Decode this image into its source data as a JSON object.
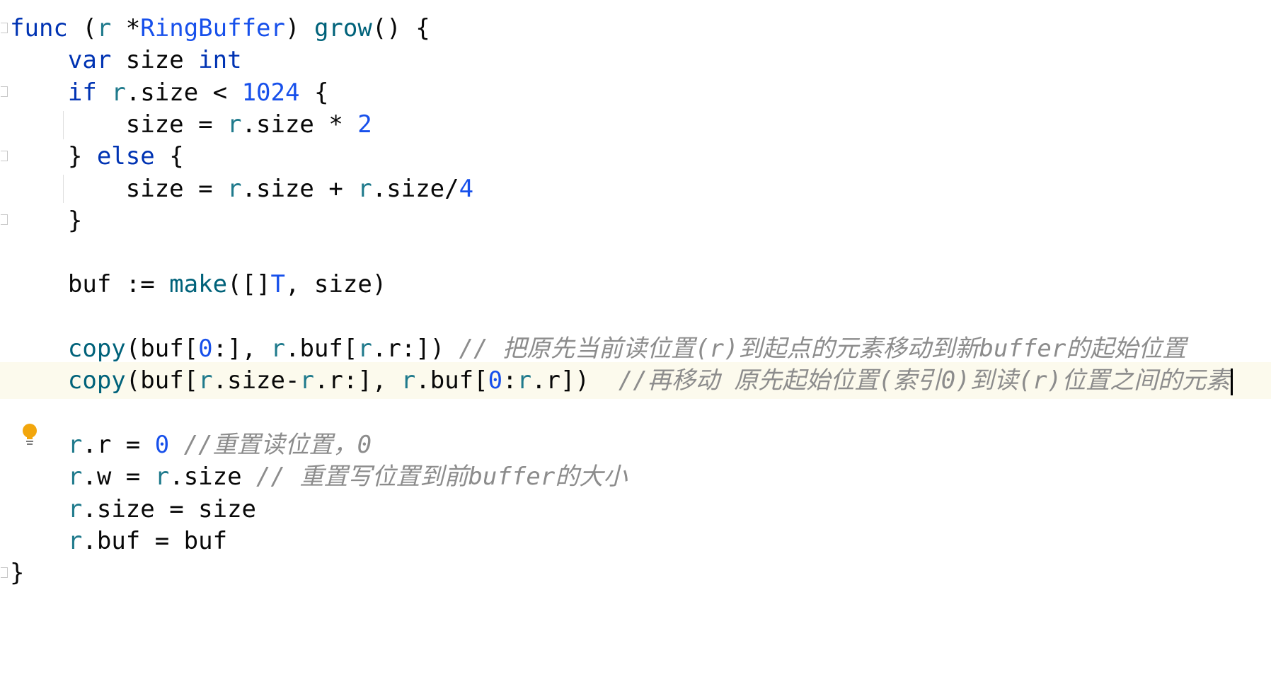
{
  "editor": {
    "language": "go",
    "lines": [
      [
        {
          "c": "kw",
          "t": "func"
        },
        {
          "t": " ("
        },
        {
          "c": "rv",
          "t": "r"
        },
        {
          "t": " *"
        },
        {
          "c": "ty",
          "t": "RingBuffer"
        },
        {
          "t": ") "
        },
        {
          "c": "fn",
          "t": "grow"
        },
        {
          "t": "() {"
        }
      ],
      [
        {
          "t": "    "
        },
        {
          "c": "kw",
          "t": "var"
        },
        {
          "t": " size "
        },
        {
          "c": "kw",
          "t": "int"
        }
      ],
      [
        {
          "t": "    "
        },
        {
          "c": "kw",
          "t": "if"
        },
        {
          "t": " "
        },
        {
          "c": "rv",
          "t": "r"
        },
        {
          "t": ".size < "
        },
        {
          "c": "num",
          "t": "1024"
        },
        {
          "t": " {"
        }
      ],
      [
        {
          "t": "        size = "
        },
        {
          "c": "rv",
          "t": "r"
        },
        {
          "t": ".size * "
        },
        {
          "c": "num",
          "t": "2"
        }
      ],
      [
        {
          "t": "    } "
        },
        {
          "c": "kw",
          "t": "else"
        },
        {
          "t": " {"
        }
      ],
      [
        {
          "t": "        size = "
        },
        {
          "c": "rv",
          "t": "r"
        },
        {
          "t": ".size + "
        },
        {
          "c": "rv",
          "t": "r"
        },
        {
          "t": ".size/"
        },
        {
          "c": "num",
          "t": "4"
        }
      ],
      [
        {
          "t": "    }"
        }
      ],
      [],
      [
        {
          "t": "    buf := "
        },
        {
          "c": "fn",
          "t": "make"
        },
        {
          "t": "([]"
        },
        {
          "c": "ty",
          "t": "T"
        },
        {
          "t": ", size)"
        }
      ],
      [],
      [
        {
          "t": "    "
        },
        {
          "c": "fn",
          "t": "copy"
        },
        {
          "t": "(buf["
        },
        {
          "c": "num",
          "t": "0"
        },
        {
          "t": ":], "
        },
        {
          "c": "rv",
          "t": "r"
        },
        {
          "t": ".buf["
        },
        {
          "c": "rv",
          "t": "r"
        },
        {
          "t": ".r:]) "
        },
        {
          "c": "cmt",
          "t": "// 把原先当前读位置(r)到起点的元素移动到新buffer的起始位置"
        }
      ],
      [
        {
          "t": "    "
        },
        {
          "c": "fn",
          "t": "copy"
        },
        {
          "t": "(buf["
        },
        {
          "c": "rv",
          "t": "r"
        },
        {
          "t": ".size-"
        },
        {
          "c": "rv",
          "t": "r"
        },
        {
          "t": ".r:], "
        },
        {
          "c": "rv",
          "t": "r"
        },
        {
          "t": ".buf["
        },
        {
          "c": "num",
          "t": "0"
        },
        {
          "t": ":"
        },
        {
          "c": "rv",
          "t": "r"
        },
        {
          "t": ".r])  "
        },
        {
          "c": "cmt",
          "t": "//再移动 原先起始位置(索引0)到读(r)位置之间的元素"
        }
      ],
      [],
      [
        {
          "t": "    "
        },
        {
          "c": "rv",
          "t": "r"
        },
        {
          "t": ".r = "
        },
        {
          "c": "num",
          "t": "0"
        },
        {
          "t": " "
        },
        {
          "c": "cmt",
          "t": "//重置读位置，0"
        }
      ],
      [
        {
          "t": "    "
        },
        {
          "c": "rv",
          "t": "r"
        },
        {
          "t": ".w = "
        },
        {
          "c": "rv",
          "t": "r"
        },
        {
          "t": ".size "
        },
        {
          "c": "cmt",
          "t": "// 重置写位置到前buffer的大小"
        }
      ],
      [
        {
          "t": "    "
        },
        {
          "c": "rv",
          "t": "r"
        },
        {
          "t": ".size = size"
        }
      ],
      [
        {
          "t": "    "
        },
        {
          "c": "rv",
          "t": "r"
        },
        {
          "t": ".buf = buf"
        }
      ],
      [
        {
          "t": "}"
        }
      ]
    ],
    "current_line_index": 11,
    "gutter_icon": "intention-bulb-icon",
    "colors": {
      "keyword": "#0033b3",
      "function": "#00627a",
      "type": "#1750eb",
      "receiver": "#1f7a8c",
      "number": "#1750eb",
      "comment": "#8c8c8c",
      "current_line": "#fcfaed",
      "bulb": "#f2a60c"
    }
  }
}
